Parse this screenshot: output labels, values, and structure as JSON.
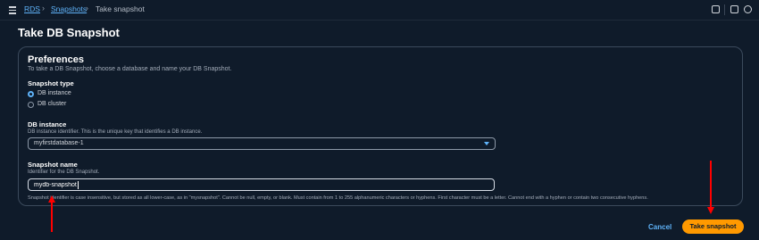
{
  "breadcrumb": {
    "items": [
      "RDS",
      "Snapshots",
      "Take snapshot"
    ],
    "separator": "›"
  },
  "page": {
    "title": "Take DB Snapshot"
  },
  "preferences": {
    "title": "Preferences",
    "description": "To take a DB Snapshot, choose a database and name your DB Snapshot."
  },
  "snapshot_type": {
    "label": "Snapshot type",
    "options": [
      {
        "label": "DB instance",
        "checked": true
      },
      {
        "label": "DB cluster",
        "checked": false
      }
    ]
  },
  "db_instance": {
    "label": "DB instance",
    "description": "DB instance identifier. This is the unique key that identifies a DB instance.",
    "selected": "myfirstdatabase-1"
  },
  "snapshot_name": {
    "label": "Snapshot name",
    "description": "Identifier for the DB Snapshot.",
    "value": "mydb-snapshot",
    "constraint": "Snapshot identifier is case insensitive, but stored as all lower-case, as in \"mysnapshot\". Cannot be null, empty, or blank. Must contain from 1 to 255 alphanumeric characters or hyphens. First character must be a letter. Cannot end with a hyphen or contain two consecutive hyphens."
  },
  "actions": {
    "cancel": "Cancel",
    "submit": "Take snapshot"
  },
  "colors": {
    "background": "#0f1b2a",
    "accent": "#5fb3f9",
    "primary_button": "#ff9900",
    "annotation_arrow": "#ff0000"
  },
  "icons": [
    "menu-icon",
    "monitor-icon",
    "info-icon",
    "settings-icon"
  ]
}
